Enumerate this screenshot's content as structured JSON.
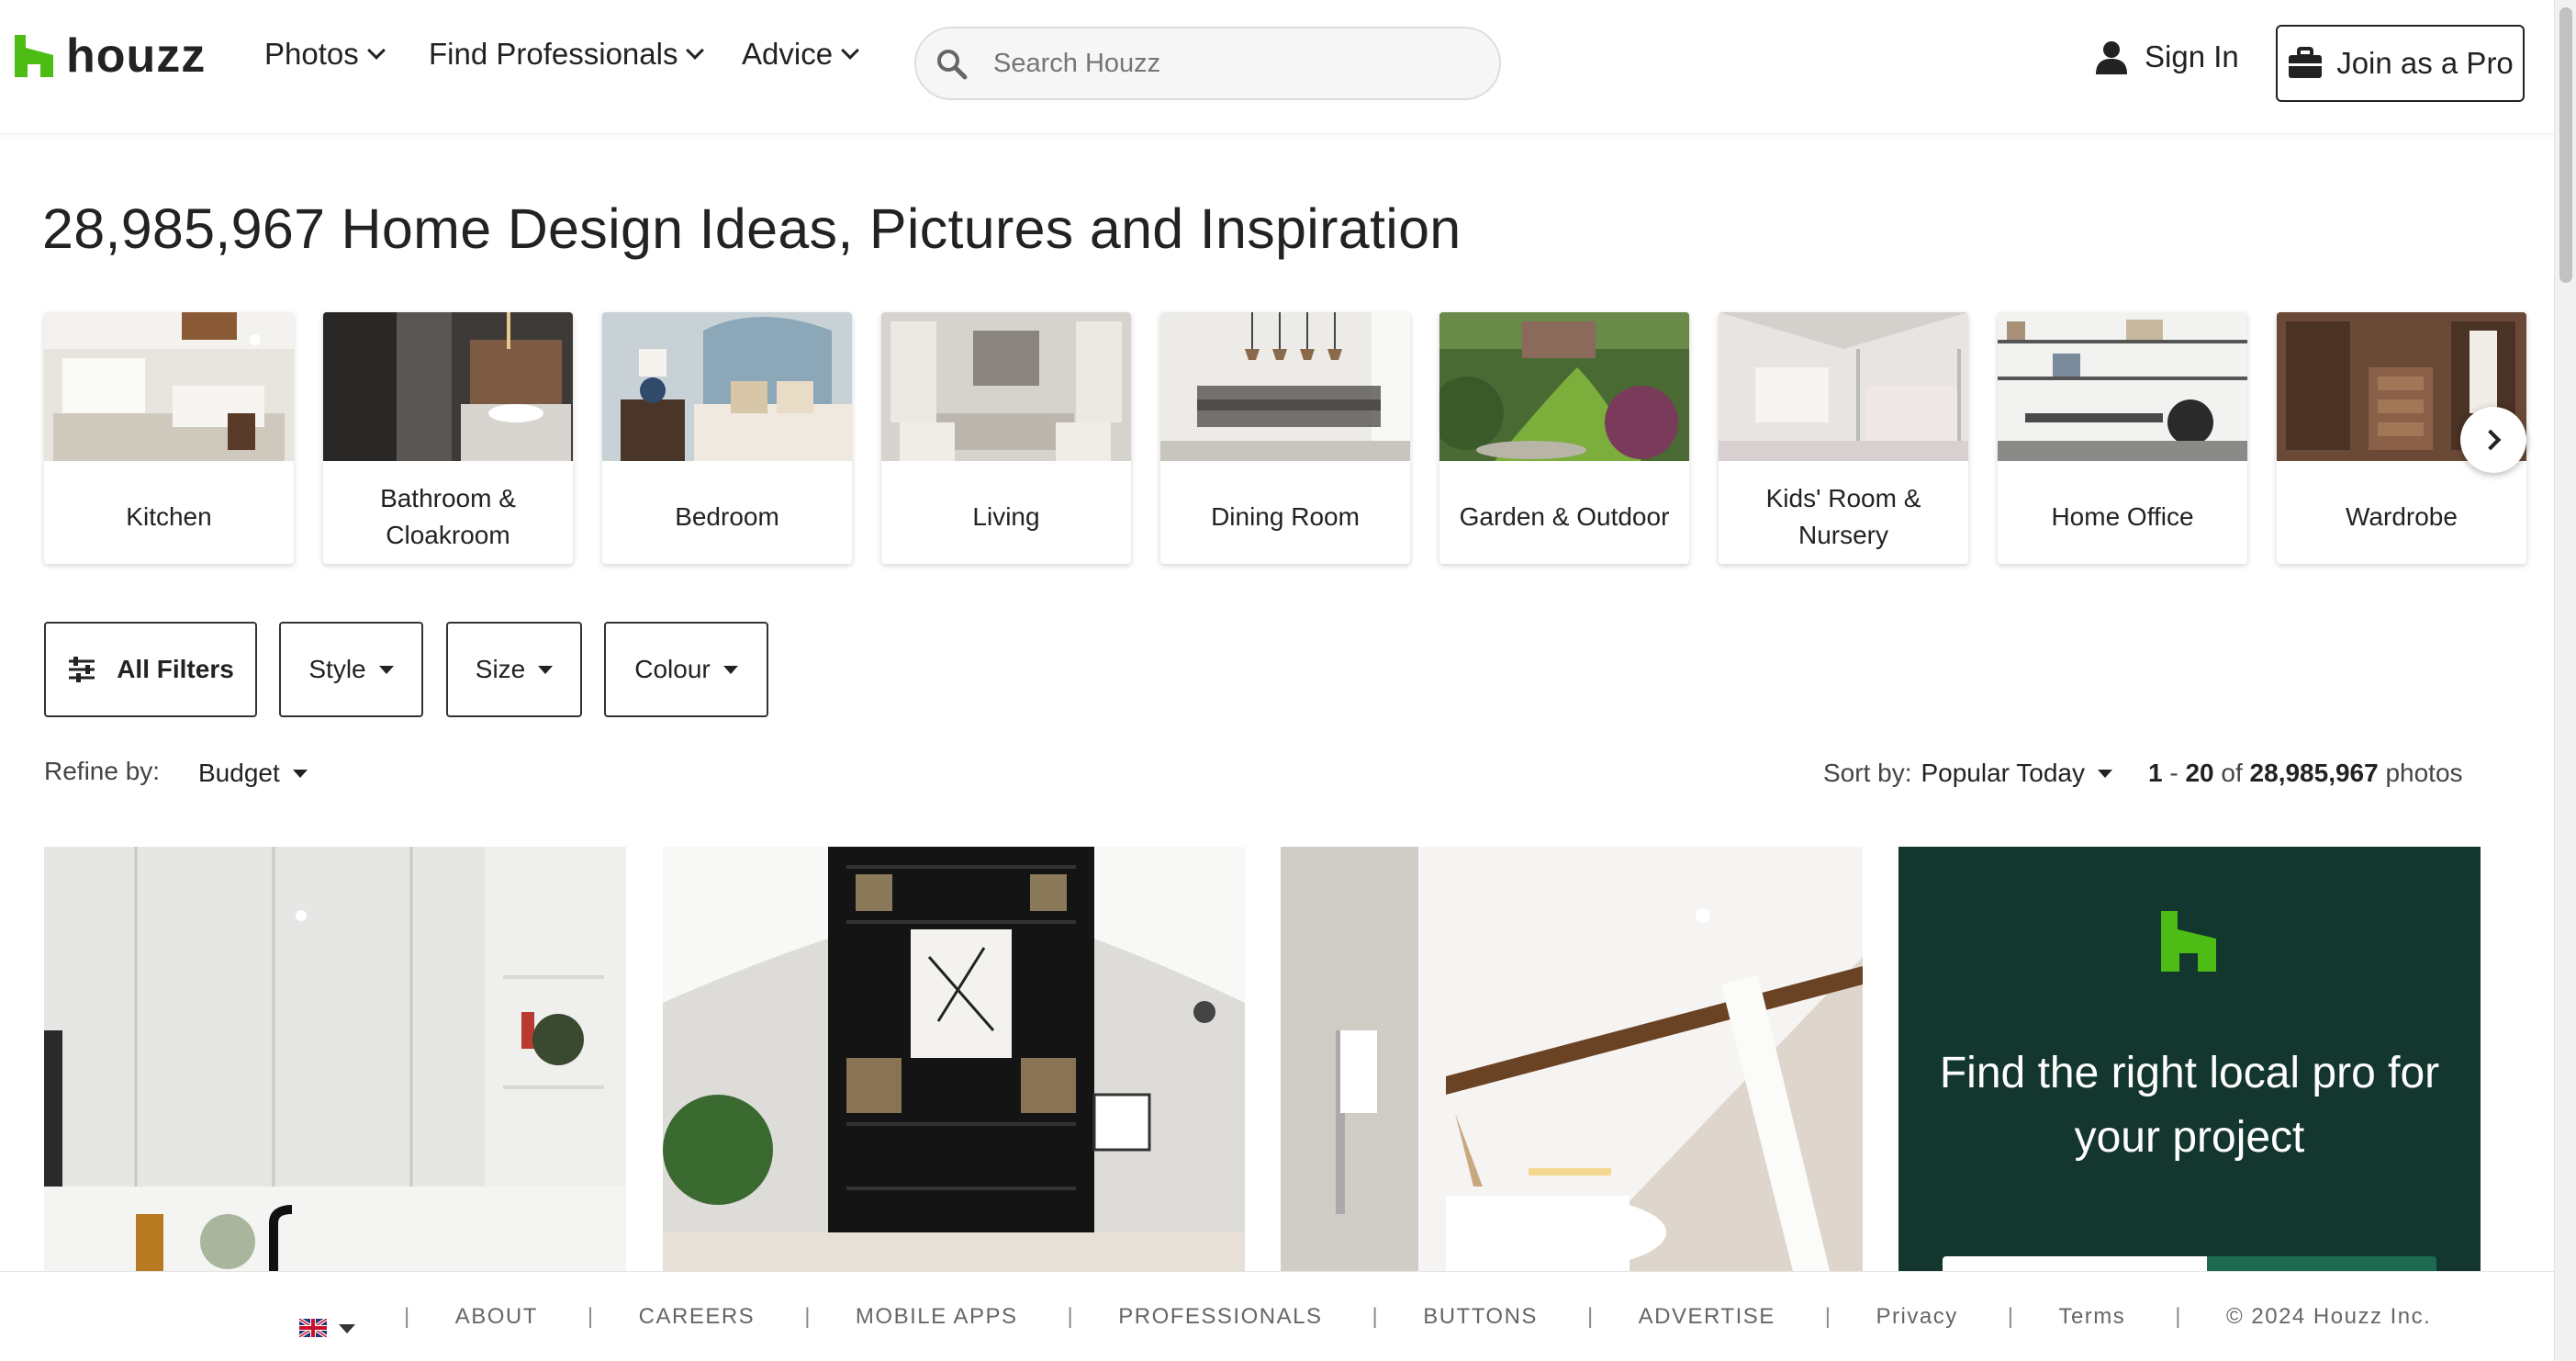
{
  "header": {
    "logo_text": "houzz",
    "nav": [
      {
        "label": "Photos"
      },
      {
        "label": "Find Professionals"
      },
      {
        "label": "Advice"
      }
    ],
    "search_placeholder": "Search Houzz",
    "sign_in": "Sign In",
    "join_pro": "Join as a Pro"
  },
  "page_title": "28,985,967 Home Design Ideas, Pictures and Inspiration",
  "categories": [
    {
      "label": "Kitchen"
    },
    {
      "label": "Bathroom & Cloakroom"
    },
    {
      "label": "Bedroom"
    },
    {
      "label": "Living"
    },
    {
      "label": "Dining Room"
    },
    {
      "label": "Garden & Outdoor"
    },
    {
      "label": "Kids' Room & Nursery"
    },
    {
      "label": "Home Office"
    },
    {
      "label": "Wardrobe"
    }
  ],
  "filters": {
    "all_filters": "All Filters",
    "style": "Style",
    "size": "Size",
    "colour": "Colour"
  },
  "refine": {
    "label": "Refine by:",
    "budget": "Budget"
  },
  "sort": {
    "label": "Sort by:",
    "value": "Popular Today"
  },
  "count": {
    "start": "1",
    "dash": "-",
    "end": "20",
    "of": "of",
    "total": "28,985,967",
    "unit": "photos"
  },
  "promo": {
    "text": "Find the right local pro for your project"
  },
  "footer": {
    "links": [
      "ABOUT",
      "CAREERS",
      "MOBILE APPS",
      "PROFESSIONALS",
      "BUTTONS",
      "ADVERTISE",
      "Privacy",
      "Terms"
    ],
    "copyright": "© 2024 Houzz Inc."
  },
  "colors": {
    "brand_green": "#4dbc15",
    "promo_bg": "#13372e"
  }
}
